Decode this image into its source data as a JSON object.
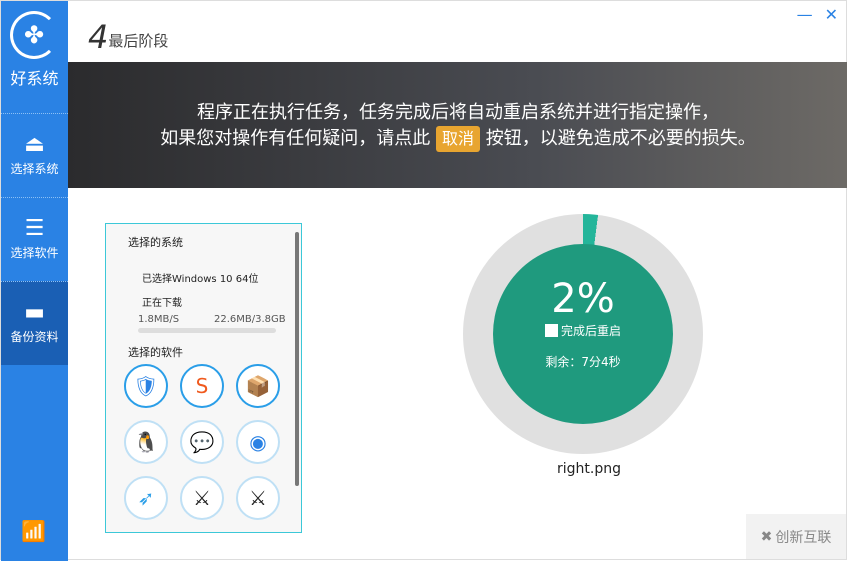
{
  "sidebar": {
    "brand": "好系统",
    "items": [
      {
        "label": "选择系统"
      },
      {
        "label": "选择软件"
      },
      {
        "label": "备份资料"
      }
    ]
  },
  "header": {
    "step": "4",
    "title": "最后阶段"
  },
  "banner": {
    "line1": "程序正在执行任务，任务完成后将自动重启系统并进行指定操作，",
    "line2a": "如果您对操作有任何疑问，请点此",
    "cancel": "取消",
    "line2b": "按钮，以避免造成不必要的损失。"
  },
  "panel": {
    "sys_heading": "选择的系统",
    "selected": "已选择Windows 10 64位",
    "downloading": "正在下载",
    "speed": "1.8MB/S",
    "size": "22.6MB/3.8GB",
    "soft_heading": "选择的软件"
  },
  "progress": {
    "percent_label": "2%",
    "percent": 2,
    "restart_label": "完成后重启",
    "remaining": "剩余：7分4秒"
  },
  "caption": "right.png",
  "watermark": "创新互联"
}
